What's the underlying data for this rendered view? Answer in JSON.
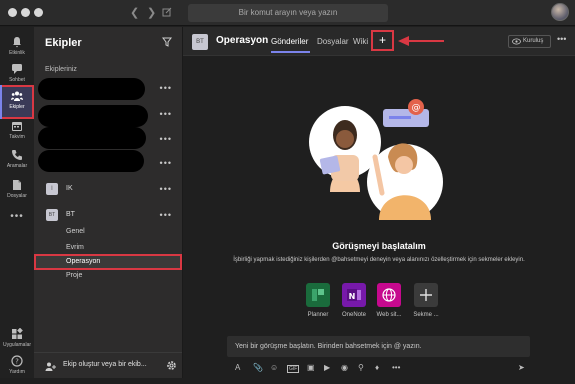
{
  "titlebar": {
    "search_placeholder": "Bir komut arayın veya yazın"
  },
  "rail": [
    {
      "label": "Etkinlik",
      "icon": "bell-icon"
    },
    {
      "label": "Sohbet",
      "icon": "chat-icon"
    },
    {
      "label": "Ekipler",
      "icon": "teams-icon",
      "active": true
    },
    {
      "label": "Takvim",
      "icon": "calendar-icon"
    },
    {
      "label": "Aramalar",
      "icon": "phone-icon"
    },
    {
      "label": "Dosyalar",
      "icon": "file-icon"
    },
    {
      "label": "",
      "icon": "more-apps-icon"
    },
    {
      "label": "Uygulamalar",
      "icon": "apps-icon"
    },
    {
      "label": "Yardım",
      "icon": "help-icon"
    }
  ],
  "sidebar": {
    "title": "Ekipler",
    "section": "Ekipleriniz",
    "teams": [
      {
        "initials": "İ",
        "name": "IK"
      },
      {
        "initials": "BT",
        "name": "BT"
      }
    ],
    "channels": [
      "Genel",
      "Evrim",
      "Operasyon",
      "Proje"
    ],
    "footer": "Ekip oluştur veya bir ekib..."
  },
  "header": {
    "initials": "BT",
    "title": "Operasyon",
    "tabs": [
      "Gönderiler",
      "Dosyalar",
      "Wiki"
    ],
    "add_tab": "+",
    "meet": "Kuruluş"
  },
  "welcome": {
    "title": "Görüşmeyi başlatalım",
    "subtitle": "İşbirliği yapmak istediğiniz kişilerden @bahsetmeyi deneyin veya alanınızı özelleştirmek için sekmeler ekleyin."
  },
  "apps": [
    {
      "label": "Planner",
      "color": "#1a6b3c"
    },
    {
      "label": "OneNote",
      "color": "#7719aa"
    },
    {
      "label": "Web sit...",
      "color": "#c6098e"
    },
    {
      "label": "Sekme ...",
      "color": "#3b3b3b"
    }
  ],
  "compose": {
    "placeholder": "Yeni bir görüşme başlatın. Birinden bahsetmek için @ yazın."
  },
  "colors": {
    "accent": "#7b83eb",
    "highlight": "#d93843"
  }
}
